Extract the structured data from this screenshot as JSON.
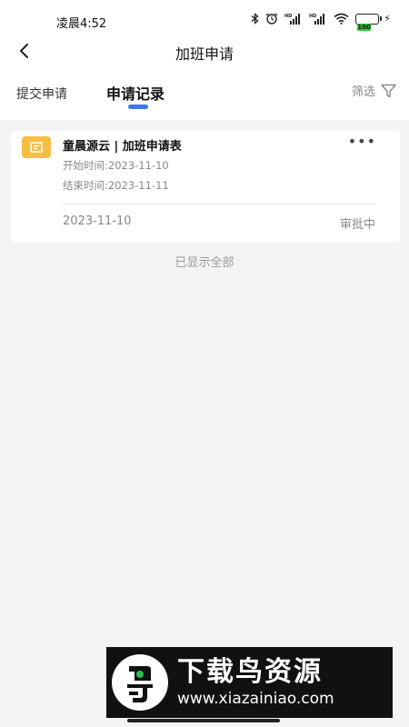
{
  "status_bar": {
    "time": "凌晨4:52",
    "battery": "100",
    "signal_1_label": "HD",
    "signal_2_label": "HD"
  },
  "header": {
    "title": "加班申请"
  },
  "tabs": {
    "submit": "提交申请",
    "records": "申请记录",
    "active": "records",
    "filter_label": "筛选"
  },
  "colors": {
    "accent": "#3a78e8",
    "doc_icon": "#f7be44"
  },
  "records": [
    {
      "title": "童晨源云 | 加班申请表",
      "start_line": "开始时间:2023-11-10",
      "end_line": "结束时间:2023-11-11",
      "date": "2023-11-10",
      "status": "审批中"
    }
  ],
  "footer_note": "已显示全部",
  "watermark": {
    "title": "下载鸟资源",
    "url": "www.xiazainiao.com"
  }
}
